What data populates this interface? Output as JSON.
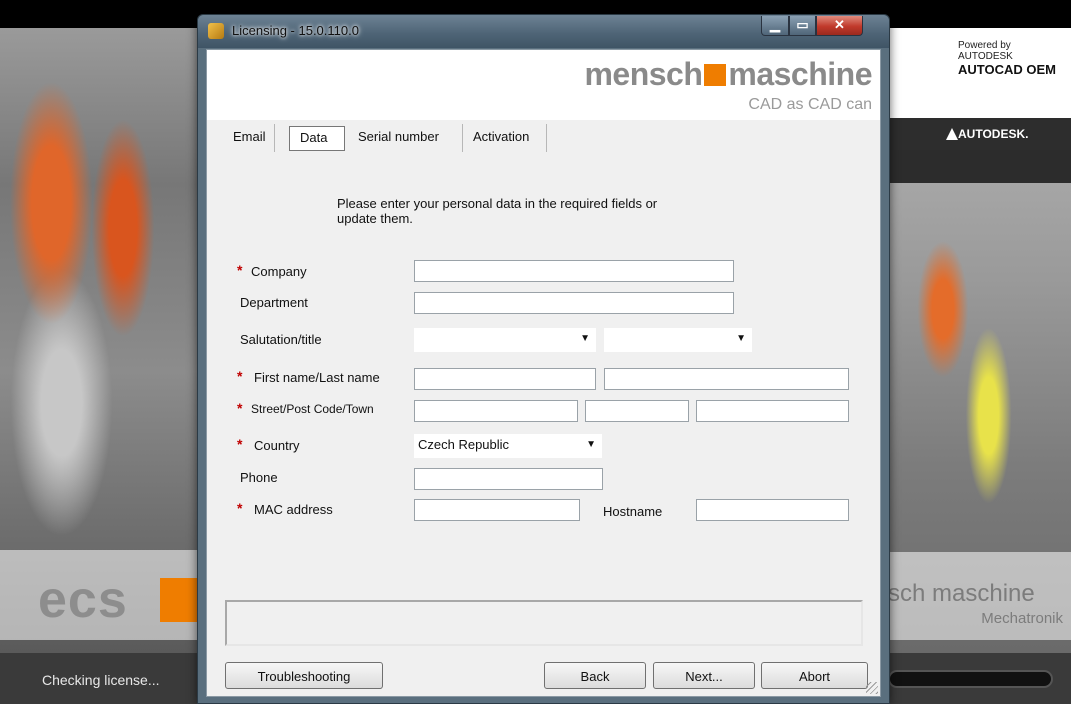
{
  "window": {
    "title": "Licensing - 15.0.110.0",
    "controls": {
      "minimize": "▁",
      "maximize": "▭",
      "close": "✕"
    }
  },
  "header": {
    "brand": "mensch",
    "brand2": "maschine",
    "tagline": "CAD as CAD can"
  },
  "tabs": [
    {
      "label": "Email",
      "selected": false
    },
    {
      "label": "Data",
      "selected": true
    },
    {
      "label": "Serial number",
      "selected": false
    },
    {
      "label": "Activation",
      "selected": false
    }
  ],
  "intro": "Please enter your personal data in the required fields or update them.",
  "form": {
    "required_mark": "*",
    "company_label": "Company",
    "department_label": "Department",
    "salutation_label": "Salutation/title",
    "name_label": "First name/Last name",
    "street_label": "Street/Post Code/Town",
    "country_label": "Country",
    "country_value": "Czech Republic",
    "phone_label": "Phone",
    "mac_label": "MAC address",
    "hostname_label": "Hostname"
  },
  "buttons": {
    "troubleshooting": "Troubleshooting",
    "back": "Back",
    "next": "Next...",
    "abort": "Abort"
  },
  "splash": {
    "status": "Checking license...",
    "powered_by": "Powered by",
    "autodesk": "AUTODESK",
    "autocad_oem": "AUTOCAD OEM",
    "autodesk_bar": "AUTODESK.",
    "ecs": "ecs",
    "mm_brand": "sch maschine",
    "mm_sub": "Mechatronik"
  },
  "colors": {
    "accent_orange": "#ef7d00",
    "required_red": "#c00000",
    "window_chrome": "#4f6577"
  }
}
